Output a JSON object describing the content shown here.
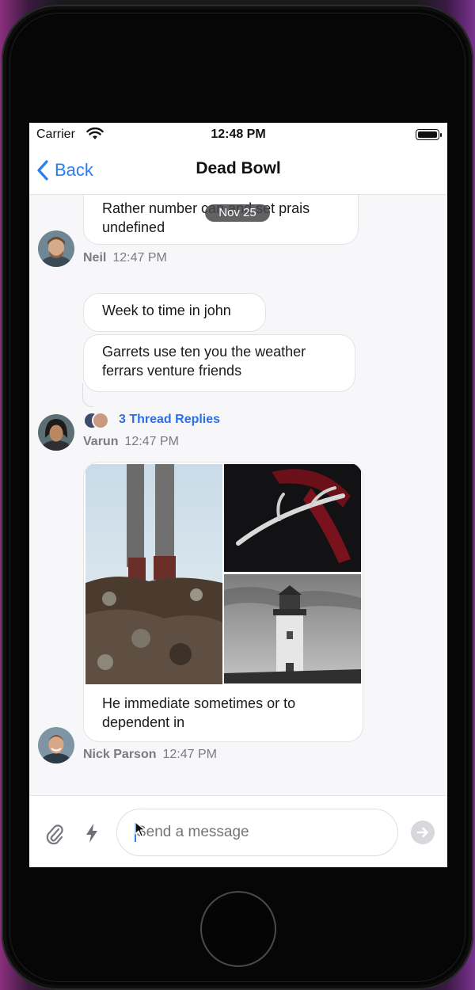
{
  "status_bar": {
    "carrier": "Carrier",
    "time": "12:48 PM"
  },
  "nav": {
    "back_label": "Back",
    "title": "Dead Bowl"
  },
  "date_separator": "Nov 25",
  "messages": [
    {
      "text": "Rather number can and set prais undefined",
      "author": "Neil",
      "time": "12:47 PM"
    },
    {
      "text": "Week to time in john"
    },
    {
      "text": "Garrets use ten you the weather ferrars venture friends",
      "author": "Varun",
      "time": "12:47 PM"
    },
    {
      "caption": "He immediate sometimes or to dependent in",
      "author": "Nick Parson",
      "time": "12:47 PM"
    }
  ],
  "thread": {
    "replies_label": "3 Thread Replies"
  },
  "composer": {
    "placeholder": "Send a message"
  },
  "icons": {
    "attach": "paperclip-icon",
    "commands": "lightning-icon",
    "send": "send-arrow-icon",
    "back": "chevron-left-icon"
  },
  "colors": {
    "accent": "#2a7ef0",
    "link": "#2a6fe8",
    "bubble_bg": "#ffffff",
    "screen_bg": "#f7f7f9"
  }
}
